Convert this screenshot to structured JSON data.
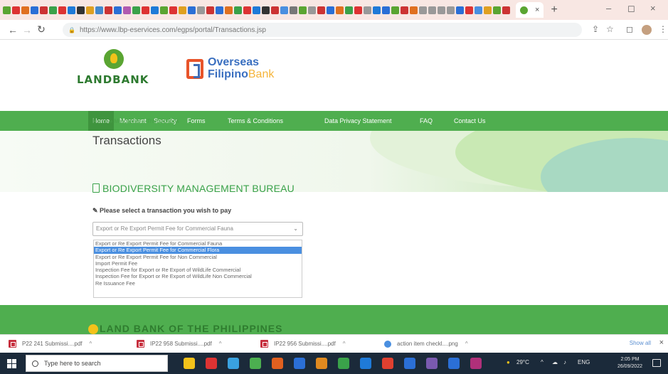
{
  "browser": {
    "active_tab_close": "×",
    "new_tab": "+",
    "window_controls": {
      "minimize": "–",
      "restore": "◻",
      "close": "×"
    },
    "url": "https://www.lbp-eservices.com/egps/portal/Transactions.jsp",
    "tab_favicon_colors": [
      "#5aa532",
      "#d33",
      "#e07020",
      "#2b6fd6",
      "#c33",
      "#3aa24a",
      "#d33",
      "#1f7ad8",
      "#333",
      "#e0a020",
      "#4488cc",
      "#cc3333",
      "#2b6fd6",
      "#b05ab0",
      "#3aa24a",
      "#d33",
      "#1f7ad8",
      "#5aa532",
      "#d33",
      "#e0a020",
      "#2b6fd6",
      "#999",
      "#c33",
      "#2b6fd6",
      "#e07020",
      "#3aa24a",
      "#d33",
      "#1f7ad8",
      "#333",
      "#c33",
      "#4a8fe0",
      "#777",
      "#5aa532",
      "#999",
      "#c33",
      "#2b6fd6",
      "#e07020",
      "#3aa24a",
      "#d33",
      "#999",
      "#1f7ad8",
      "#2b6fd6",
      "#5aa532",
      "#c33",
      "#e07020",
      "#999",
      "#999",
      "#999",
      "#999",
      "#2b6fd6",
      "#d33",
      "#4a8fe0",
      "#e0a020",
      "#5aa532",
      "#c33"
    ]
  },
  "header": {
    "landbank_name": "LANDBANK",
    "ofb_line1": "Overseas",
    "ofb_line2_a": "Filipino",
    "ofb_line2_b": "Bank"
  },
  "nav": {
    "items": [
      "Home",
      "Merchant",
      "Security",
      "Forms",
      "Terms & Conditions",
      "Data Privacy Statement",
      "FAQ",
      "Contact Us"
    ]
  },
  "breadcrumb": "Home » Merchants » Transactions",
  "page_title": "Transactions",
  "merchant_name": "BIODIVERSITY MANAGEMENT BUREAU",
  "prompt": "Please select a transaction you wish to pay",
  "select": {
    "current": "Export or Re Export Permit Fee for Commercial Fauna",
    "options": [
      "Export or Re Export Permit Fee for Commercial Fauna",
      "Export or Re Export Permit Fee for Commercial Flora",
      "Export or Re Export Permit Fee for Non Commercial",
      "Import Permit Fee",
      "Inspection Fee for Export or Re Export of WildLife Commercial",
      "Inspection Fee for Export or Re Export of WildLife Non Commercial",
      "Re Issuance Fee"
    ],
    "highlighted_index": 1
  },
  "footer": {
    "band_text": "LAND BANK OF THE PHILIPPINES"
  },
  "downloads": {
    "items": [
      {
        "name": "P22 241 Submissi....pdf",
        "type": "pdf"
      },
      {
        "name": "IP22 958 Submissi....pdf",
        "type": "pdf"
      },
      {
        "name": "IP22 956 Submissi....pdf",
        "type": "pdf"
      },
      {
        "name": "action item checkl....png",
        "type": "image"
      }
    ],
    "show_all": "Show all",
    "close": "×"
  },
  "taskbar": {
    "search_placeholder": "Type here to search",
    "app_colors": [
      "#f3c21a",
      "#d33",
      "#3aa2e0",
      "#4caf50",
      "#e06020",
      "#2b6fd6",
      "#e08a20",
      "#3aa24a",
      "#1f7ad8",
      "#e04030",
      "#2b6fd6",
      "#7a5ab0",
      "#2b6fd6",
      "#b0307a"
    ],
    "weather": "29°C",
    "lang": "ENG",
    "time": "2:05 PM",
    "date": "26/09/2022"
  },
  "colors": {
    "nav_green": "#4fae4f",
    "brand_green": "#3aa24a",
    "highlight_blue": "#4a8fe0"
  }
}
